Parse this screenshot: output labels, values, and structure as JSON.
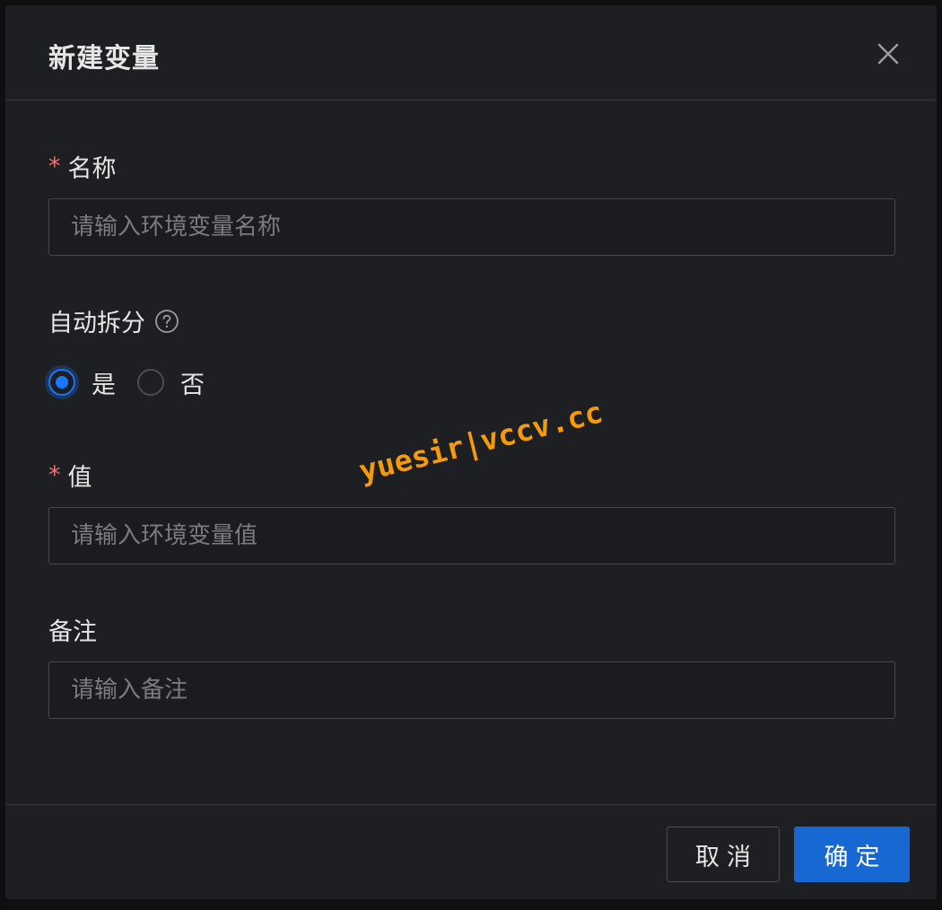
{
  "dialog": {
    "title": "新建变量",
    "close_icon": "close-icon"
  },
  "fields": {
    "name": {
      "required": true,
      "label": "名称",
      "placeholder": "请输入环境变量名称",
      "value": ""
    },
    "auto_split": {
      "label": "自动拆分",
      "help_icon": "question-circle-icon",
      "options": [
        {
          "label": "是",
          "checked": true
        },
        {
          "label": "否",
          "checked": false
        }
      ]
    },
    "value": {
      "required": true,
      "label": "值",
      "placeholder": "请输入环境变量值",
      "value": ""
    },
    "remark": {
      "required": false,
      "label": "备注",
      "placeholder": "请输入备注",
      "value": ""
    }
  },
  "footer": {
    "cancel_label": "取消",
    "ok_label": "确定"
  },
  "watermark": "yuesir|vccv.cc",
  "colors": {
    "background": "#1e1f22",
    "primary": "#1768d2",
    "required_star": "#f56c6c",
    "watermark": "#f59a0b"
  }
}
